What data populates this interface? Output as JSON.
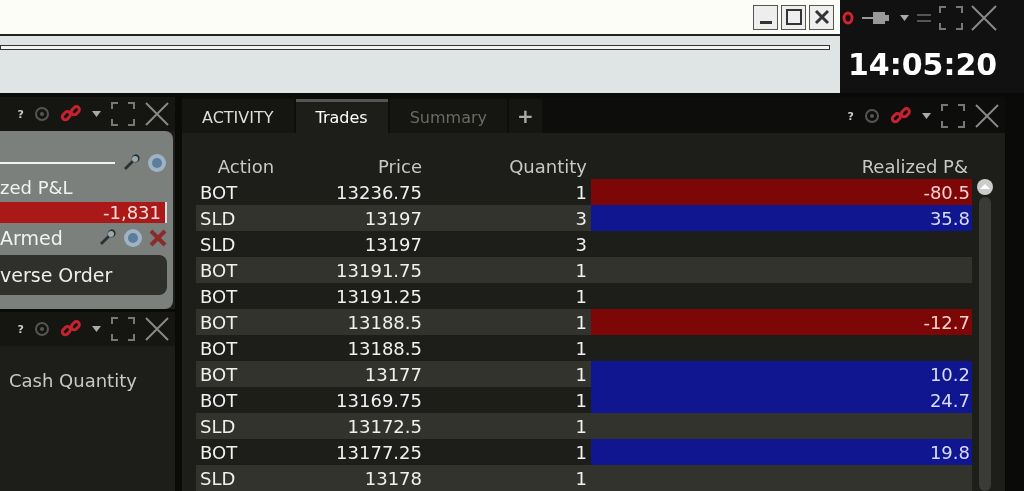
{
  "clock": {
    "time": "14:05:20"
  },
  "left_panel": {
    "help": "?",
    "pnl_label": "zed P&L",
    "pnl_value": "-1,831",
    "armed_label": "Armed",
    "button": "verse Order"
  },
  "left_panel_2": {
    "help": "?",
    "label": "Cash Quantity"
  },
  "trades_panel": {
    "help": "?",
    "tabs": [
      {
        "label": "ACTIVITY",
        "selected": false,
        "disabled": false
      },
      {
        "label": "Trades",
        "selected": true,
        "disabled": false
      },
      {
        "label": "Summary",
        "selected": false,
        "disabled": true
      }
    ],
    "add_tab": "+",
    "columns": [
      "Action",
      "Price",
      "Quantity",
      "Realized P&"
    ],
    "rows": [
      {
        "action": "BOT",
        "price": "13236.75",
        "quantity": "1",
        "kind": "loss",
        "pnl": "-80.5"
      },
      {
        "action": "SLD",
        "price": "13197",
        "quantity": "3",
        "kind": "gain",
        "pnl": "35.8"
      },
      {
        "action": "SLD",
        "price": "13197",
        "quantity": "3",
        "kind": "none"
      },
      {
        "action": "BOT",
        "price": "13191.75",
        "quantity": "1",
        "kind": "none"
      },
      {
        "action": "BOT",
        "price": "13191.25",
        "quantity": "1",
        "kind": "none"
      },
      {
        "action": "BOT",
        "price": "13188.5",
        "quantity": "1",
        "kind": "loss",
        "pnl": "-12.7"
      },
      {
        "action": "BOT",
        "price": "13188.5",
        "quantity": "1",
        "kind": "none"
      },
      {
        "action": "BOT",
        "price": "13177",
        "quantity": "1",
        "kind": "gain",
        "pnl": "10.2"
      },
      {
        "action": "BOT",
        "price": "13169.75",
        "quantity": "1",
        "kind": "gain",
        "pnl": "24.7"
      },
      {
        "action": "SLD",
        "price": "13172.5",
        "quantity": "1",
        "kind": "none"
      },
      {
        "action": "BOT",
        "price": "13177.25",
        "quantity": "1",
        "kind": "gain",
        "pnl": "19.8"
      },
      {
        "action": "SLD",
        "price": "13178",
        "quantity": "1",
        "kind": "none"
      }
    ]
  }
}
